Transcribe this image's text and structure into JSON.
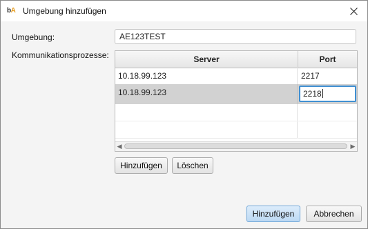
{
  "window": {
    "title": "Umgebung hinzufügen",
    "logo_text_b": "b",
    "logo_text_o": "A"
  },
  "form": {
    "environment_label": "Umgebung:",
    "environment_value": "AE123TEST",
    "processes_label": "Kommunikationsprozesse:"
  },
  "table": {
    "columns": [
      "Server",
      "Port"
    ],
    "rows": [
      {
        "server": "10.18.99.123",
        "port": "2217"
      },
      {
        "server": "10.18.99.123",
        "port": "2218"
      }
    ],
    "selected_row": 1
  },
  "table_buttons": {
    "add_label": "Hinzufügen",
    "delete_label": "Löschen"
  },
  "dialog_buttons": {
    "add_label": "Hinzufügen",
    "cancel_label": "Abbrechen"
  }
}
